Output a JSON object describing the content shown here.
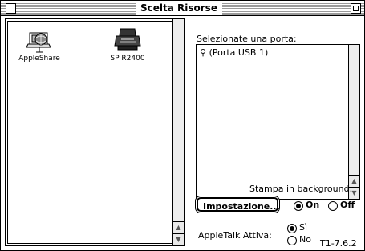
{
  "window": {
    "title": "Scelta Risorse"
  },
  "resources": [
    {
      "label": "AppleShare",
      "icon": "appleshare-icon"
    },
    {
      "label": "SP R2400",
      "icon": "printer-icon",
      "selected": true
    }
  ],
  "port_panel": {
    "prompt": "Selezionate una porta:",
    "ports": [
      {
        "icon": "usb-icon",
        "label": "(Porta USB 1)"
      }
    ]
  },
  "background_print": {
    "label": "Stampa in background:",
    "setup_button": "Impostazione...",
    "on_label": "On",
    "off_label": "Off",
    "selected": "On"
  },
  "appletalk": {
    "label": "AppleTalk Attiva:",
    "yes_label": "Sì",
    "no_label": "No",
    "selected": "Sì"
  },
  "version": "T1-7.6.2"
}
